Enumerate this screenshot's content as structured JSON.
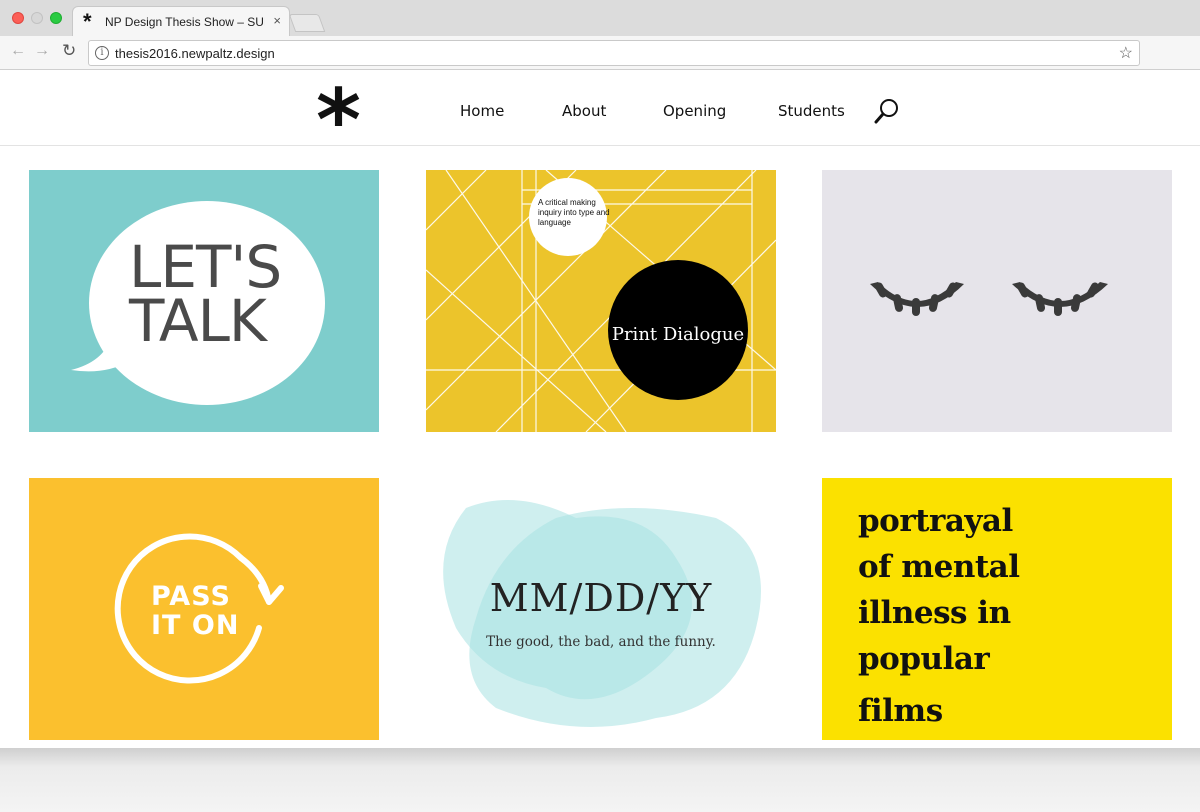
{
  "browser": {
    "tab_title": "NP Design Thesis Show – SUNY",
    "tab_favicon": "*",
    "tab_close": "×",
    "url": "thesis2016.newpaltz.design",
    "icons": [
      "back-arrow-icon",
      "forward-arrow-icon",
      "reload-icon",
      "info-icon",
      "bookmark-star-icon"
    ]
  },
  "site": {
    "logo": "*",
    "nav": [
      "Home",
      "About",
      "Opening",
      "Students"
    ],
    "search_icon": "magnifier-icon"
  },
  "tiles": [
    {
      "text_lines": [
        "LET'S",
        "TALK"
      ],
      "bg": "#7ecdcc"
    },
    {
      "small_text": "A critical making inquiry into type and language",
      "title": "Print Dialogue",
      "bg": "#ecc42b"
    },
    {
      "icon": "closed-eyes-icon",
      "bg": "#e6e4ea"
    },
    {
      "text_lines": [
        "PASS",
        "IT ON"
      ],
      "bg": "#fbc02e"
    },
    {
      "title": "MM/DD/YY",
      "subtitle": "The good, the bad, and the funny.",
      "bg": "#ffffff"
    },
    {
      "text_lines": [
        "portrayal",
        "of mental",
        "illness in",
        "popular",
        "films"
      ],
      "bg": "#fbe100"
    }
  ]
}
